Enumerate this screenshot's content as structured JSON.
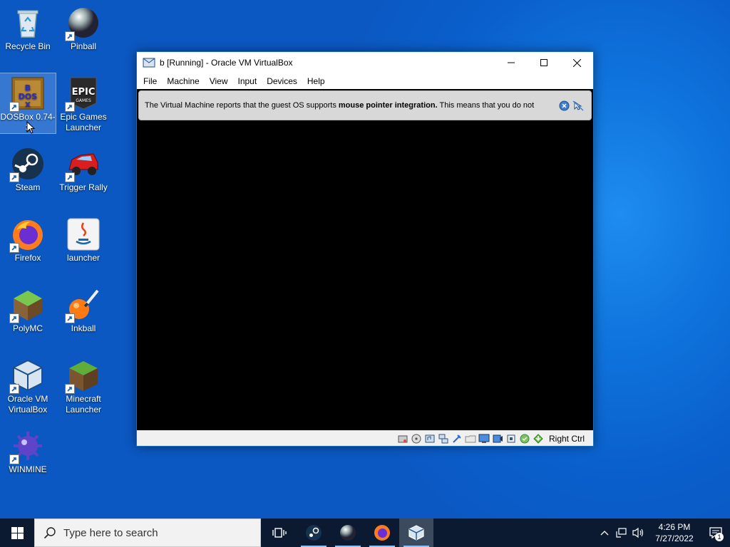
{
  "desktop": {
    "icons": [
      {
        "label": "Recycle Bin"
      },
      {
        "label": "Pinball"
      },
      {
        "label": "DOSBox 0.74-3"
      },
      {
        "label": "Epic Games Launcher"
      },
      {
        "label": "Steam"
      },
      {
        "label": "Trigger Rally"
      },
      {
        "label": "Firefox"
      },
      {
        "label": "launcher"
      },
      {
        "label": "PolyMC"
      },
      {
        "label": "Inkball"
      },
      {
        "label": "Oracle VM VirtualBox"
      },
      {
        "label": "Minecraft Launcher"
      },
      {
        "label": "WINMINE"
      }
    ]
  },
  "window": {
    "title": "b [Running] - Oracle VM VirtualBox",
    "menu": [
      "File",
      "Machine",
      "View",
      "Input",
      "Devices",
      "Help"
    ],
    "notice_prefix": "The Virtual Machine reports that the guest OS supports ",
    "notice_bold": "mouse pointer integration.",
    "notice_suffix": " This means that you do not",
    "host_key": "Right Ctrl"
  },
  "taskbar": {
    "search_placeholder": "Type here to search",
    "time": "4:26 PM",
    "date": "7/27/2022",
    "notification_count": "1"
  },
  "colors": {
    "accent": "#0a5fcc",
    "taskbar": "#0b1a31"
  }
}
